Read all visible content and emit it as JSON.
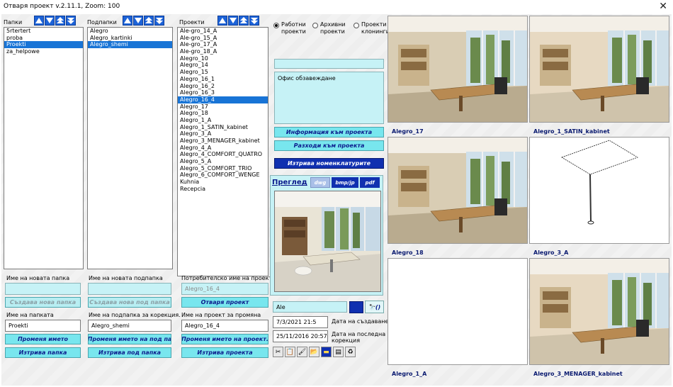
{
  "window": {
    "title": "Отваря проект v.2.11.1, Zoom:  100",
    "close_glyph": "✕"
  },
  "folders": {
    "label": "Папки",
    "items": [
      "5rtertert",
      "proba",
      "Proekti",
      "za_helpowe"
    ],
    "selected": 2
  },
  "subfolders": {
    "label": "Подпапки",
    "items": [
      "Alegro",
      "Alegro_kartinki",
      "Alegro_shemi"
    ],
    "selected": 2
  },
  "projects": {
    "label": "Проекти",
    "items": [
      "Ale-gro_14_A",
      "Ale-gro_15_A",
      "Ale-gro_17_A",
      "Ale-gro_18_A",
      "Alegro_10",
      "Alegro_14",
      "Alegro_15",
      "Alegro_16_1",
      "Alegro_16_2",
      "Alegro_16_3",
      "Alegro_16_4",
      "Alegro_17",
      "Alegro_18",
      "Alegro_1_A",
      "Alegro_1_SATIN_kabinet",
      "Alegro_3_A",
      "Alegro_3_MENAGER_kabinet",
      "Alegro_4_A",
      "Alegro_4_COMFORT_QUATRO",
      "Alegro_5_A",
      "Alegro_5_COMFORT_TRIO",
      "Alegro_6_COMFORT_WENGE",
      "Kuhnia",
      "Recepcia"
    ],
    "selected": 10
  },
  "new_folder": {
    "label": "Име на новата папка",
    "value": "",
    "button": "Създава нова папка"
  },
  "new_subfolder": {
    "label": "Име на новата подпапка",
    "value": "",
    "button": "Създава нова под папка"
  },
  "user_project": {
    "label": "Потребителско име на проекта",
    "value": "Alegro_16_4",
    "button": "Отваря проект"
  },
  "rename_folder": {
    "label": "Име на папката",
    "value": "Proekti",
    "rename_button": "Променя името",
    "delete_button": "Изтрива папка"
  },
  "rename_subfolder": {
    "label": "Име на подпапка за корекция.",
    "value": "Alegro_shemi",
    "rename_button": "Променя името на под па",
    "delete_button": "Изтрива под папка"
  },
  "rename_project": {
    "label": "Име на проект за промяна",
    "value": "Alegro_16_4",
    "rename_button": "Променя името на проект.",
    "delete_button": "Изтрива проекта"
  },
  "radios": [
    {
      "label1": "Работни",
      "label2": "проекти",
      "checked": true
    },
    {
      "label1": "Архивни",
      "label2": "проекти",
      "checked": false
    },
    {
      "label1": "Проекти",
      "label2": "клонинги",
      "checked": false
    }
  ],
  "description": {
    "text": "Офис обзавеждане"
  },
  "actions": {
    "info": "Информация към проекта",
    "costs": "Разходи към проекта",
    "delete_nomenclatures": "Изтрива номенклатурите"
  },
  "preview": {
    "label": "Преглед",
    "tabs": [
      "dwg",
      "bmp/jp",
      "pdf"
    ]
  },
  "search": {
    "value": "Ale",
    "find_icon": "binoculars-icon",
    "find_text": "()"
  },
  "dates": {
    "created_value": "7/3/2021 21:5",
    "created_label": "Дата на създаване",
    "modified_value": "25/11/2016 20:57",
    "modified_label1": "Дата на последна",
    "modified_label2": "корекция"
  },
  "toolbar_icons": [
    "scissors-icon",
    "paste-icon",
    "brush-icon",
    "open-folder-icon",
    "folder-dark-icon",
    "document-icon",
    "recycle-icon"
  ],
  "thumbnails": [
    {
      "caption": "Alegro_17",
      "kind": "office"
    },
    {
      "caption": "Alegro_1_SATIN_kabinet",
      "kind": "office-bright"
    },
    {
      "caption": "Alegro_18",
      "kind": "office"
    },
    {
      "caption": "Alegro_3_A",
      "kind": "sketch"
    },
    {
      "caption": "Alegro_1_A",
      "kind": "blank"
    },
    {
      "caption": "Alegro_3_MENAGER_kabinet",
      "kind": "office-bright"
    }
  ],
  "colors": {
    "accent": "#1d63d8",
    "selection": "#1874d6",
    "field": "#c6f2f6",
    "button": "#78e6ee",
    "button_text": "#0b1a8c"
  }
}
